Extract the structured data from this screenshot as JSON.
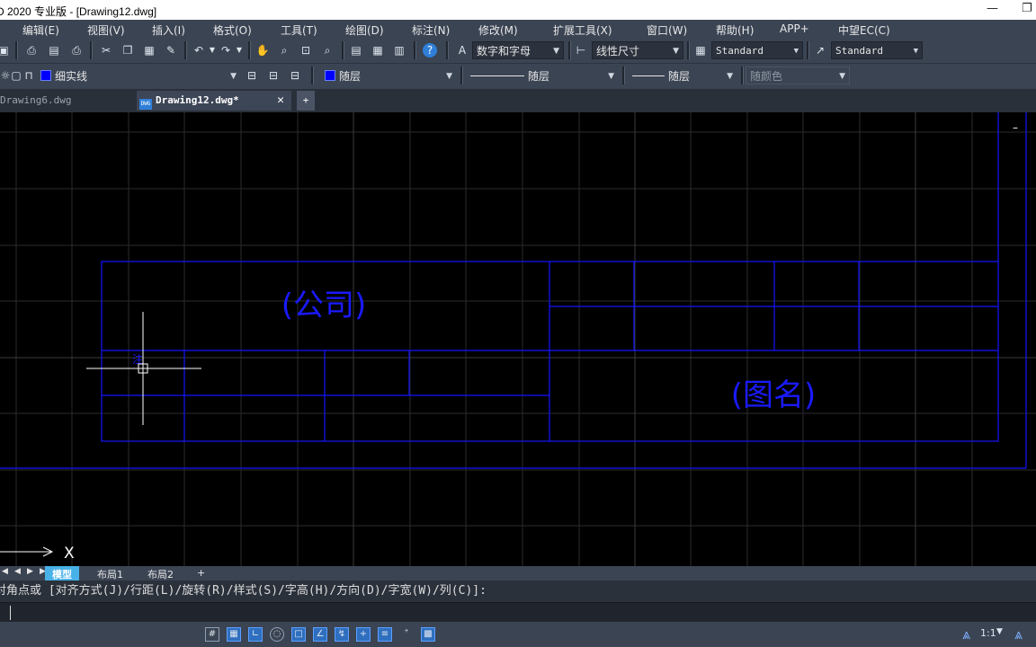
{
  "window": {
    "title": "D 2020 专业版 - [Drawing12.dwg]"
  },
  "menu": [
    "编辑(E)",
    "视图(V)",
    "插入(I)",
    "格式(O)",
    "工具(T)",
    "绘图(D)",
    "标注(N)",
    "修改(M)",
    "扩展工具(X)",
    "窗口(W)",
    "帮助(H)",
    "APP+",
    "中望EC(C)"
  ],
  "toolbar": {
    "text_style": "数字和字母",
    "dim_style": "线性尺寸",
    "table_style": "Standard",
    "multileader_style": "Standard",
    "layer": "细实线",
    "color": "随层",
    "linetype": "随层",
    "lineweight": "随层",
    "plot_style": "随颜色"
  },
  "doc_tabs": [
    {
      "label": "Drawing6.dwg",
      "active": false
    },
    {
      "label": "Drawing12.dwg*",
      "active": true
    }
  ],
  "drawing": {
    "company_text": "(公司)",
    "drawing_name_text": "(图名)",
    "cursor_text": "注",
    "axis_label": "X",
    "line_color": "#1414ff"
  },
  "layout_tabs": [
    "模型",
    "布局1",
    "布局2",
    "+"
  ],
  "command": {
    "prompt": "对角点或 [对齐方式(J)/行距(L)/旋转(R)/样式(S)/字高(H)/方向(D)/字宽(W)/列(C)]:",
    "input": ""
  },
  "status": {
    "scale": "1:1"
  }
}
